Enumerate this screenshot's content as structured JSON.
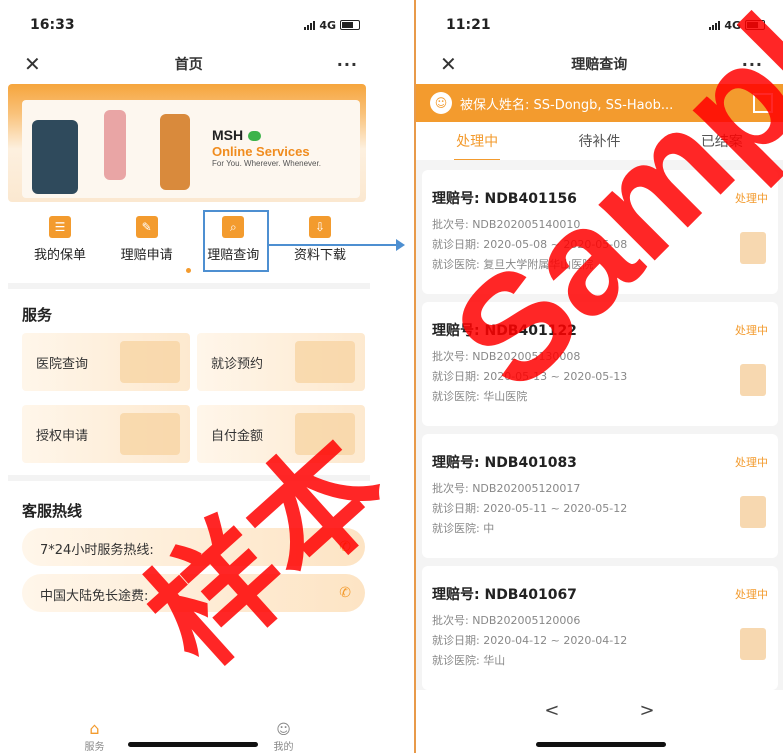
{
  "left": {
    "status": {
      "time": "16:33",
      "network": "4G"
    },
    "nav": {
      "title": "首页",
      "close": "✕",
      "more": "···"
    },
    "banner": {
      "brand": "MSH",
      "service": "Online Services",
      "tagline": "For You. Wherever. Whenever."
    },
    "quick_menu": [
      {
        "label": "我的保单",
        "icon": "policy-icon"
      },
      {
        "label": "理赔申请",
        "icon": "edit-icon"
      },
      {
        "label": "理赔查询",
        "icon": "search-doc-icon"
      },
      {
        "label": "资料下载",
        "icon": "download-icon"
      }
    ],
    "services": {
      "title": "服务",
      "items": [
        {
          "label": "医院查询"
        },
        {
          "label": "就诊预约"
        },
        {
          "label": "授权申请"
        },
        {
          "label": "自付金额"
        }
      ]
    },
    "hotline": {
      "title": "客服热线",
      "items": [
        {
          "label": "7*24小时服务热线:"
        },
        {
          "label": "中国大陆免长途费:"
        }
      ]
    },
    "tabbar": {
      "home": "服务",
      "me": "我的"
    }
  },
  "right": {
    "status": {
      "time": "11:21",
      "network": "4G"
    },
    "nav": {
      "title": "理赔查询",
      "close": "✕",
      "more": "···"
    },
    "insured": "被保人姓名: SS-Dongb, SS-Haob...",
    "tabs": [
      "处理中",
      "待补件",
      "已结案"
    ],
    "claims": [
      {
        "no": "理赔号: NDB401156",
        "batch": "批次号: NDB202005140010",
        "dates": "就诊日期: 2020-05-08 ~ 2020-05-08",
        "hospital": "就诊医院: 复旦大学附属华山医院",
        "status": "处理中"
      },
      {
        "no": "理赔号: NDB401122",
        "batch": "批次号: NDB202005130008",
        "dates": "就诊日期: 2020-05-13 ~ 2020-05-13",
        "hospital": "就诊医院: 华山医院",
        "status": "处理中"
      },
      {
        "no": "理赔号: NDB401083",
        "batch": "批次号: NDB202005120017",
        "dates": "就诊日期: 2020-05-11 ~ 2020-05-12",
        "hospital": "就诊医院: 中",
        "status": "处理中"
      },
      {
        "no": "理赔号: NDB401067",
        "batch": "批次号: NDB202005120006",
        "dates": "就诊日期: 2020-04-12 ~ 2020-04-12",
        "hospital": "就诊医院: 华山",
        "status": "处理中"
      }
    ],
    "pager": {
      "prev": "<",
      "next": ">"
    }
  },
  "watermarks": {
    "en": "Sample",
    "zh": "样本"
  },
  "colors": {
    "accent": "#f39b2e",
    "highlight": "#4d8fd1",
    "watermark": "#ff0000"
  }
}
